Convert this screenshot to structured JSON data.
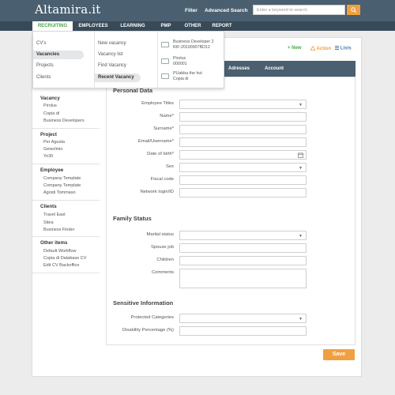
{
  "header": {
    "logo": "Altamira.it",
    "filter_label": "Filter",
    "advanced_search_label": "Advanced Search",
    "search_placeholder": "Enter a keyword to search",
    "accent": "#f0a040",
    "bar_color": "#4a5f6f"
  },
  "nav": {
    "items": [
      {
        "label": "RECRUITING",
        "active": true
      },
      {
        "label": "EMPLOYEES"
      },
      {
        "label": "LEARNING"
      },
      {
        "label": "PMP"
      },
      {
        "label": "OTHER"
      },
      {
        "label": "REPORT"
      }
    ]
  },
  "dropdown": {
    "col1": [
      "CV's",
      "Vacancies",
      "Projects",
      "Clients"
    ],
    "col1_selected": "Vacancies",
    "col2": [
      "New vacancy",
      "Vacancy list",
      "Find Vacancy",
      "Recent Vacancy"
    ],
    "col2_selected": "Recent Vacancy",
    "recent": [
      {
        "line1": "Business Developer 2",
        "line2": "RIF:20100907BD12"
      },
      {
        "line1": "Pirolus",
        "line2": "000001"
      },
      {
        "line1": "PUabba the hut",
        "line2": "Copia di"
      }
    ]
  },
  "actions": {
    "new_label": "+ New",
    "action_label": "Action",
    "lists_label": "Lists"
  },
  "tabs": [
    "Adresses",
    "Account"
  ],
  "sidebar": [
    {
      "title": "Vacancy",
      "items": [
        "Pirolus",
        "Copia di",
        "Business Developers"
      ]
    },
    {
      "title": "Project",
      "items": [
        "Per Agusta",
        "Geisolmio",
        "Yo30"
      ]
    },
    {
      "title": "Employee",
      "items": [
        "Company Template",
        "Company Template",
        "Agosti Tommaso"
      ]
    },
    {
      "title": "Clients",
      "items": [
        "Travel East",
        "Sitea",
        "Business Finder"
      ]
    },
    {
      "title": "Other items",
      "items": [
        "Default Workflow",
        "Copia di Database CV",
        "Edit CV Backoffice"
      ]
    }
  ],
  "form": {
    "personal_title": "Personal Data",
    "personal_fields": [
      "Employee Titles",
      "Name*",
      "Surname*",
      "Email/Username*",
      "Date of birth*",
      "Sex",
      "Fiscal code",
      "Network login/ID"
    ],
    "family_title": "Family Status",
    "family_fields": [
      "Marital status",
      "Spouse job",
      "Children",
      "Comments"
    ],
    "sensitive_title": "Sensitive Information",
    "sensitive_fields": [
      "Protected Categories",
      "Disability Percentage (%)"
    ]
  },
  "save_label": "Save"
}
